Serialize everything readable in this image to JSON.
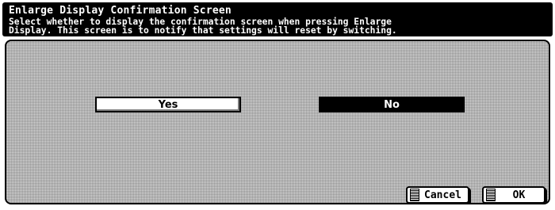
{
  "header": {
    "title": "Enlarge Display Confirmation Screen",
    "description_line1": "Select whether to display the confirmation screen when pressing Enlarge",
    "description_line2": "Display. This screen is to notify that settings will reset by switching."
  },
  "options": {
    "yes_label": "Yes",
    "no_label": "No",
    "selected": "No"
  },
  "footer": {
    "cancel_label": "Cancel",
    "ok_label": "OK"
  },
  "colors": {
    "selected_bg": "#000000",
    "unselected_bg": "#ffffff",
    "panel_pattern": "#d8d8d8"
  }
}
